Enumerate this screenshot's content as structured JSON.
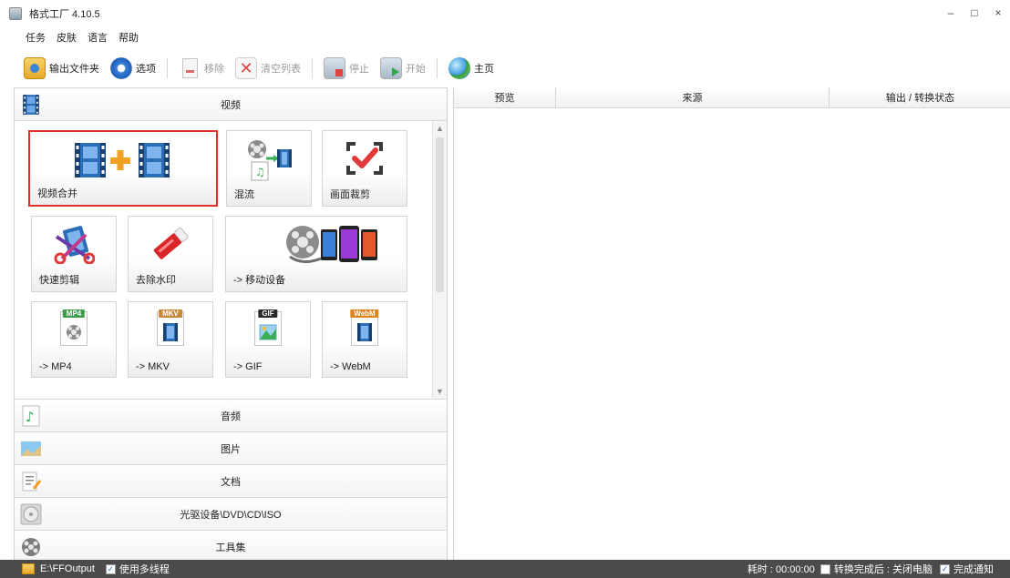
{
  "window": {
    "title": "格式工厂 4.10.5",
    "minimize": "–",
    "maximize": "□",
    "close": "×"
  },
  "menu": [
    "任务",
    "皮肤",
    "语言",
    "帮助"
  ],
  "toolbar": {
    "output_folder": "输出文件夹",
    "options": "选项",
    "remove": "移除",
    "clear_list": "清空列表",
    "stop": "停止",
    "start": "开始",
    "home": "主页"
  },
  "categories": {
    "video": "视频",
    "audio": "音频",
    "image": "图片",
    "document": "文档",
    "disc": "光驱设备\\DVD\\CD\\ISO",
    "tools": "工具集"
  },
  "tiles": {
    "merge": "视频合并",
    "mux": "混流",
    "crop": "画面裁剪",
    "quick_cut": "快速剪辑",
    "remove_watermark": "去除水印",
    "mobile": "-> 移动设备",
    "mp4": "-> MP4",
    "mkv": "-> MKV",
    "gif": "-> GIF",
    "webm": "-> WebM",
    "mp4_badge": "MP4",
    "mkv_badge": "MKV",
    "gif_badge": "GIF",
    "webm_badge": "WebM"
  },
  "task_table": {
    "columns": [
      "预览",
      "来源",
      "输出 / 转换状态"
    ]
  },
  "status": {
    "output_path": "E:\\FFOutput",
    "multithread": "使用多线程",
    "elapsed": "耗时 : 00:00:00",
    "after_convert": "转换完成后 : 关闭电脑",
    "notify": "完成通知"
  },
  "colors": {
    "accent_red": "#e0302a",
    "status_bg": "#4b4b4b",
    "film_blue": "#2c6db8"
  }
}
